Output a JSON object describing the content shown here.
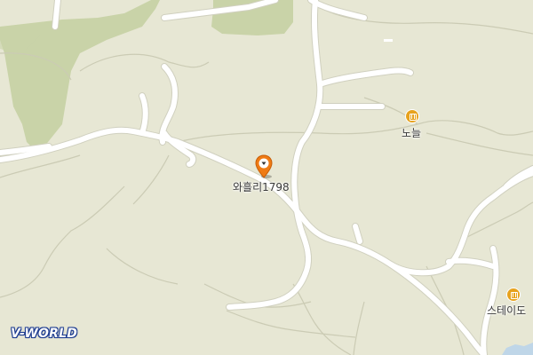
{
  "map": {
    "colors": {
      "land": "#e7e7d4",
      "forest": "#c9d3a8",
      "road": "#ffffff",
      "contour": "#c9c9b2",
      "water": "#bfd6e8",
      "poi": "#e7a21d",
      "marker": "#ef7b15"
    },
    "labels": {
      "marker_address": "와흘리1798",
      "poi_1": "노늘",
      "poi_2": "스테이도"
    },
    "marker_icon": "map-pin-icon",
    "poi_icon": "building-icon",
    "logo_text": "V-WORLD"
  }
}
